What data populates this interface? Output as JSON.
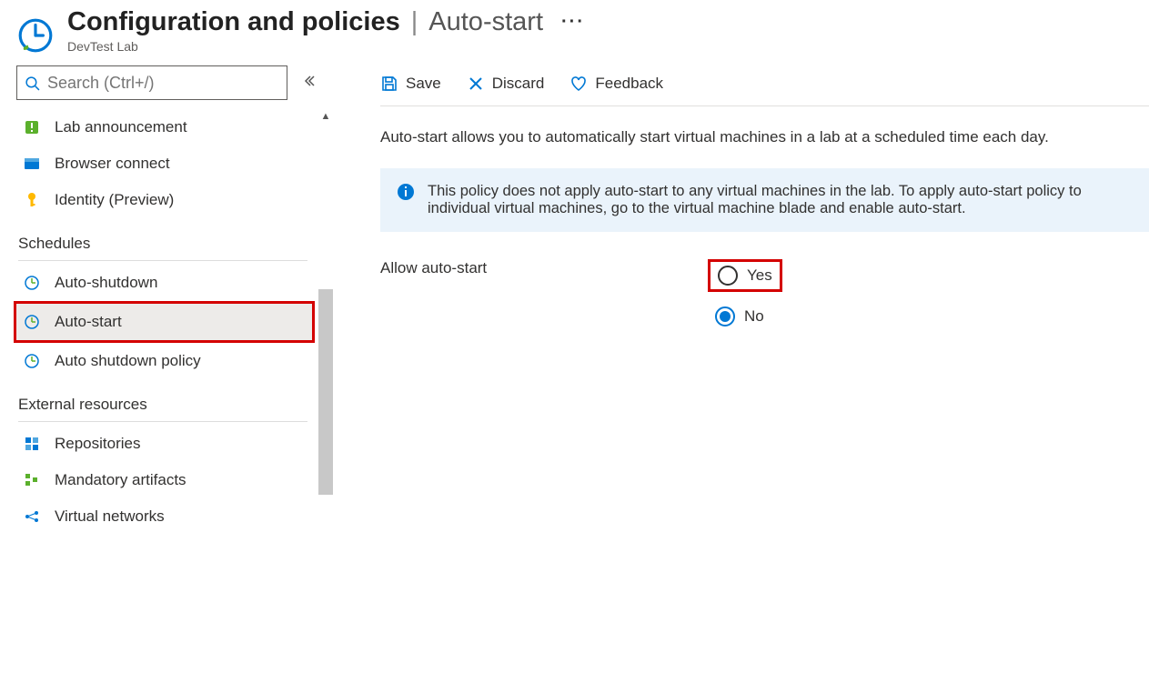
{
  "header": {
    "title": "Configuration and policies",
    "subtitle_page": "Auto-start",
    "subtitle": "DevTest Lab"
  },
  "sidebar": {
    "search_placeholder": "Search (Ctrl+/)",
    "items": [
      {
        "label": "Lab announcement"
      },
      {
        "label": "Browser connect"
      },
      {
        "label": "Identity (Preview)"
      }
    ],
    "section_schedules": "Schedules",
    "schedules": [
      {
        "label": "Auto-shutdown"
      },
      {
        "label": "Auto-start"
      },
      {
        "label": "Auto shutdown policy"
      }
    ],
    "section_external": "External resources",
    "external": [
      {
        "label": "Repositories"
      },
      {
        "label": "Mandatory artifacts"
      },
      {
        "label": "Virtual networks"
      }
    ]
  },
  "toolbar": {
    "save": "Save",
    "discard": "Discard",
    "feedback": "Feedback"
  },
  "content": {
    "description": "Auto-start allows you to automatically start virtual machines in a lab at a scheduled time each day.",
    "info": "This policy does not apply auto-start to any virtual machines in the lab. To apply auto-start policy to individual virtual machines, go to the virtual machine blade and enable auto-start.",
    "form_label": "Allow auto-start",
    "radio_yes": "Yes",
    "radio_no": "No"
  }
}
